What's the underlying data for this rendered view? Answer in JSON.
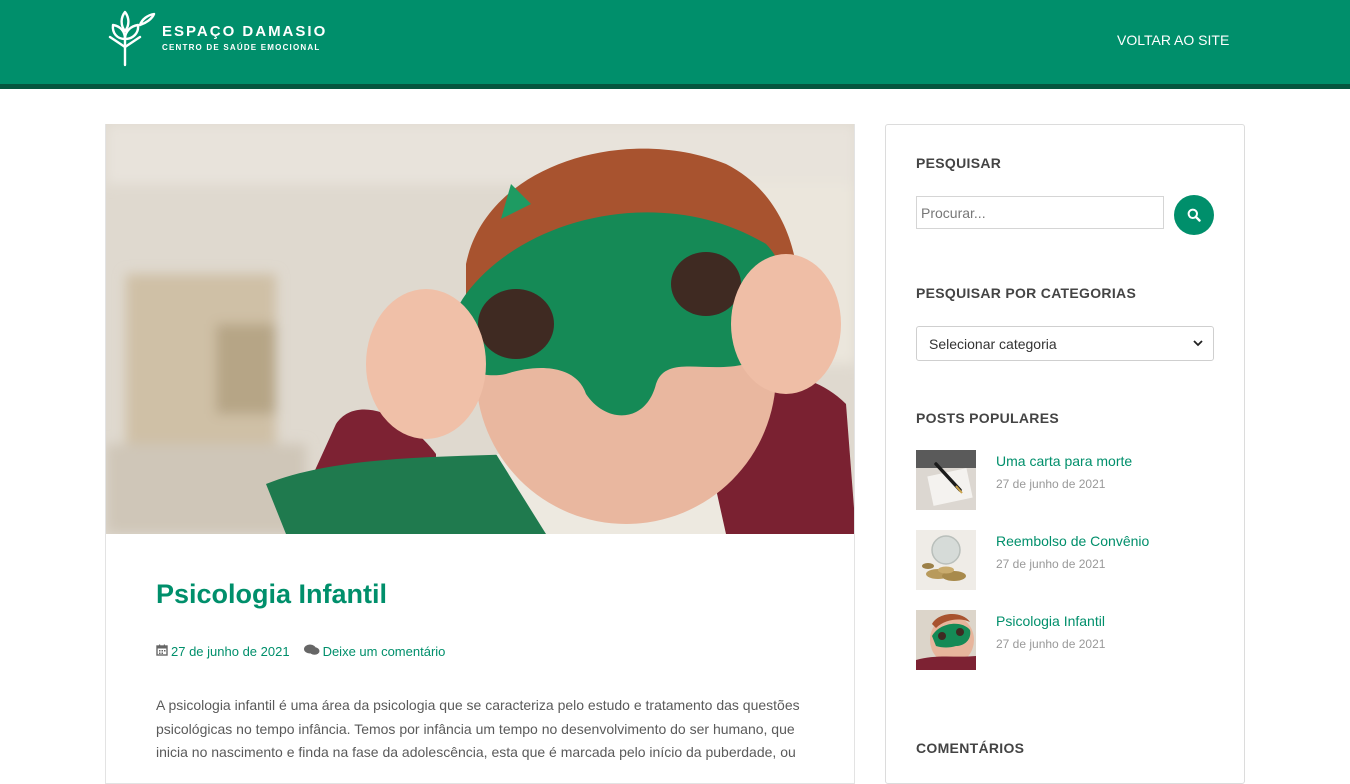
{
  "header": {
    "logo_title": "ESPAÇO DAMASIO",
    "logo_subtitle": "CENTRO DE SAÚDE EMOCIONAL",
    "back_link": "VOLTAR AO SITE",
    "bg_color": "#008f6b"
  },
  "post": {
    "title": "Psicologia Infantil",
    "date": "27 de junho de 2021",
    "comment_link": "Deixe um comentário",
    "excerpt": "A psicologia infantil é uma área da psicologia que se caracteriza pelo estudo e tratamento das questões psicológicas no tempo infância. Temos por infância um tempo no desenvolvimento do ser humano, que inicia no nascimento e finda na fase da adolescência, esta que é marcada pelo início da puberdade, ou",
    "date_icon": "calendar-icon",
    "comment_icon": "comments-icon"
  },
  "sidebar": {
    "search_title": "PESQUISAR",
    "search_placeholder": "Procurar...",
    "search_icon": "search-icon",
    "categories_title": "PESQUISAR POR CATEGORIAS",
    "category_selected": "Selecionar categoria",
    "popular_title": "POSTS POPULARES",
    "popular": [
      {
        "title": "Uma carta para morte",
        "date": "27 de junho de 2021"
      },
      {
        "title": "Reembolso de Convênio",
        "date": "27 de junho de 2021"
      },
      {
        "title": "Psicologia Infantil",
        "date": "27 de junho de 2021"
      }
    ],
    "comments_title": "COMENTÁRIOS"
  },
  "colors": {
    "accent": "#008f6b",
    "accent_dark": "#05563f"
  }
}
